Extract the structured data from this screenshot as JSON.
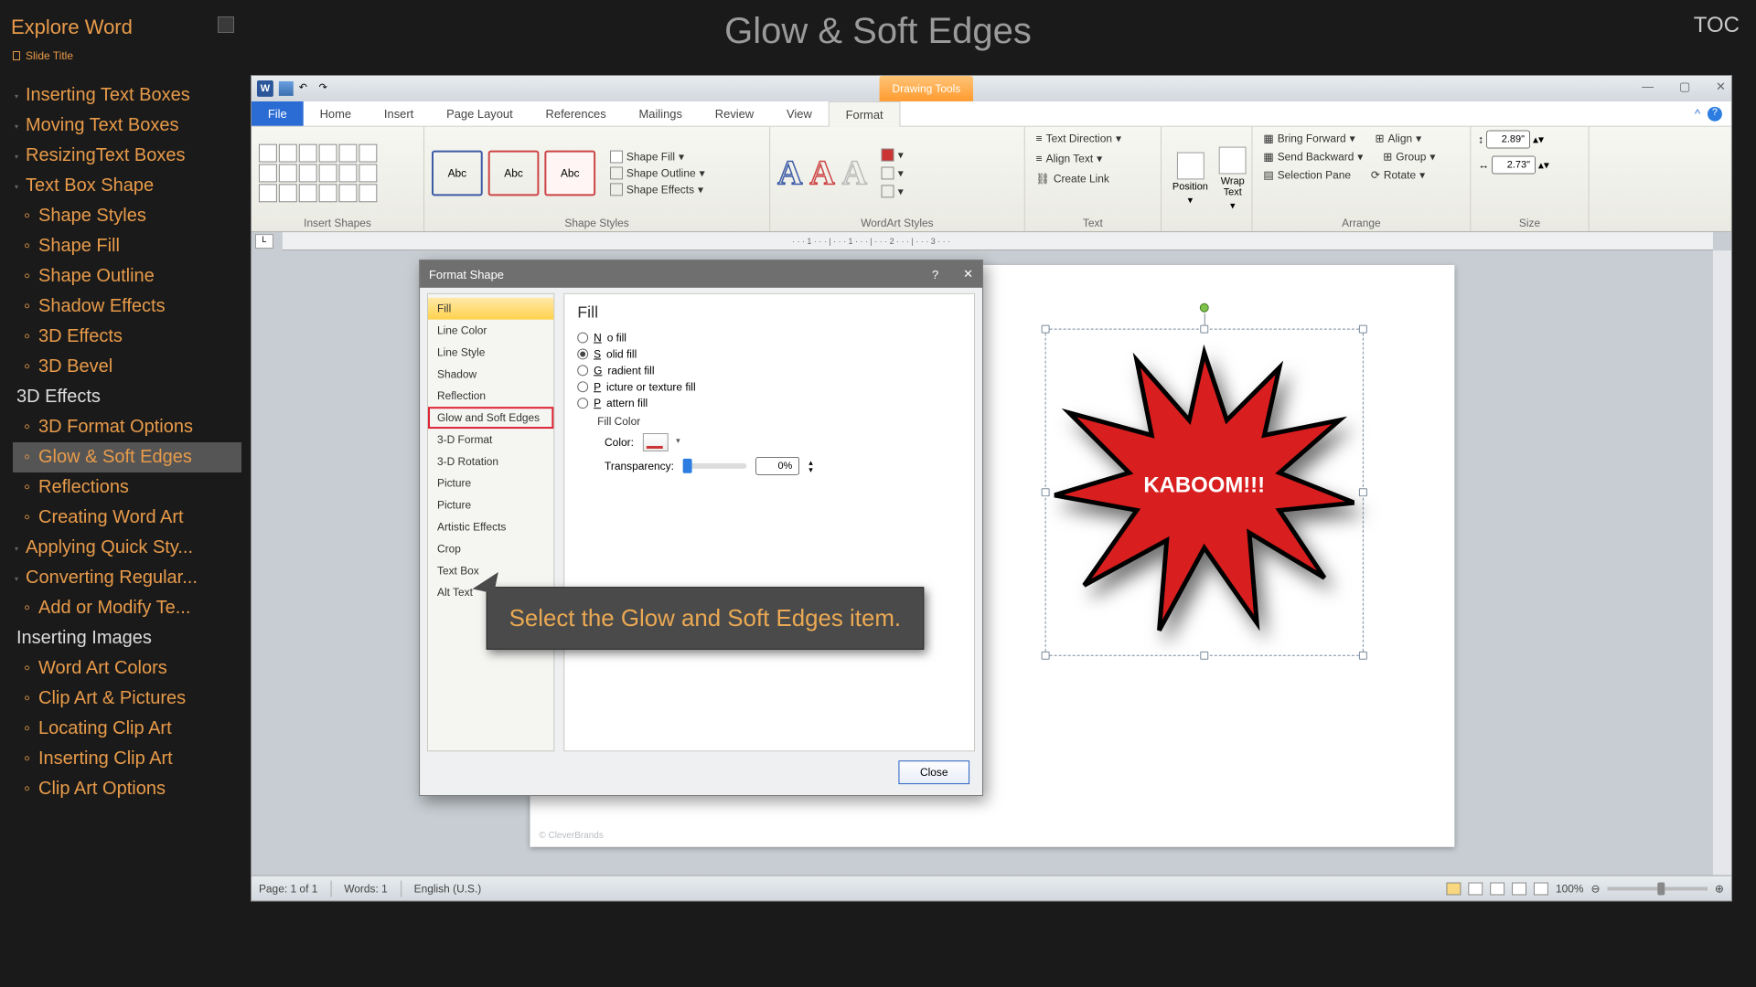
{
  "header": {
    "brand": "Explore Word",
    "slide_title_label": "Slide Title",
    "page_title": "Glow & Soft Edges",
    "toc": "TOC"
  },
  "sidebar": [
    {
      "label": "Inserting Text Boxes",
      "cls": "top"
    },
    {
      "label": "Moving Text Boxes",
      "cls": "top"
    },
    {
      "label": "ResizingText Boxes",
      "cls": "top"
    },
    {
      "label": "Text Box Shape",
      "cls": "top"
    },
    {
      "label": "Shape Styles",
      "cls": "sub"
    },
    {
      "label": "Shape Fill",
      "cls": "sub"
    },
    {
      "label": "Shape Outline",
      "cls": "sub"
    },
    {
      "label": "Shadow Effects",
      "cls": "sub"
    },
    {
      "label": "3D Effects",
      "cls": "sub"
    },
    {
      "label": "3D Bevel",
      "cls": "sub"
    },
    {
      "label": "3D Effects",
      "cls": "section"
    },
    {
      "label": "3D Format Options",
      "cls": "sub"
    },
    {
      "label": "Glow & Soft Edges",
      "cls": "sub selected"
    },
    {
      "label": "Reflections",
      "cls": "sub"
    },
    {
      "label": "Creating Word Art",
      "cls": "sub"
    },
    {
      "label": "Applying Quick Sty...",
      "cls": "top"
    },
    {
      "label": "Converting Regular...",
      "cls": "top"
    },
    {
      "label": "Add or Modify Te...",
      "cls": "sub"
    },
    {
      "label": "Inserting Images",
      "cls": "section"
    },
    {
      "label": "Word Art Colors",
      "cls": "sub"
    },
    {
      "label": "Clip Art & Pictures",
      "cls": "sub"
    },
    {
      "label": "Locating Clip Art",
      "cls": "sub"
    },
    {
      "label": "Inserting Clip Art",
      "cls": "sub"
    },
    {
      "label": "Clip Art Options",
      "cls": "sub"
    }
  ],
  "word": {
    "context_tab": "Drawing Tools",
    "tabs": [
      "File",
      "Home",
      "Insert",
      "Page Layout",
      "References",
      "Mailings",
      "Review",
      "View",
      "Format"
    ],
    "active_tab": "Format",
    "groups": {
      "insert_shapes": "Insert Shapes",
      "shape_styles": "Shape Styles",
      "style_label": "Abc",
      "shape_fill": "Shape Fill",
      "shape_outline": "Shape Outline",
      "shape_effects": "Shape Effects",
      "wordart": "WordArt Styles",
      "text": "Text",
      "text_direction": "Text Direction",
      "align_text": "Align Text",
      "create_link": "Create Link",
      "position": "Position",
      "wrap": "Wrap Text",
      "arrange": "Arrange",
      "bring_fwd": "Bring Forward",
      "send_back": "Send Backward",
      "sel_pane": "Selection Pane",
      "align": "Align",
      "group": "Group",
      "rotate": "Rotate",
      "size": "Size",
      "height": "2.89\"",
      "width": "2.73\""
    },
    "status": {
      "page": "Page: 1 of 1",
      "words": "Words: 1",
      "lang": "English (U.S.)",
      "zoom": "100%"
    },
    "copyright": "© CleverBrands"
  },
  "shape": {
    "text": "KABOOM!!!"
  },
  "dialog": {
    "title": "Format Shape",
    "side": [
      "Fill",
      "Line Color",
      "Line Style",
      "Shadow",
      "Reflection",
      "Glow and Soft Edges",
      "3-D Format",
      "3-D Rotation",
      "Picture",
      "Picture",
      "Artistic Effects",
      "Crop",
      "Text Box",
      "Alt Text"
    ],
    "selected": "Fill",
    "highlighted": "Glow and Soft Edges",
    "pane_title": "Fill",
    "radios": [
      {
        "l": "No fill",
        "on": false
      },
      {
        "l": "Solid fill",
        "on": true
      },
      {
        "l": "Gradient fill",
        "on": false
      },
      {
        "l": "Picture or texture fill",
        "on": false
      },
      {
        "l": "Pattern fill",
        "on": false
      }
    ],
    "fill_color_label": "Fill Color",
    "color_label": "Color:",
    "transparency_label": "Transparency:",
    "transparency_value": "0%",
    "close": "Close"
  },
  "callout": "Select the Glow and Soft Edges item."
}
